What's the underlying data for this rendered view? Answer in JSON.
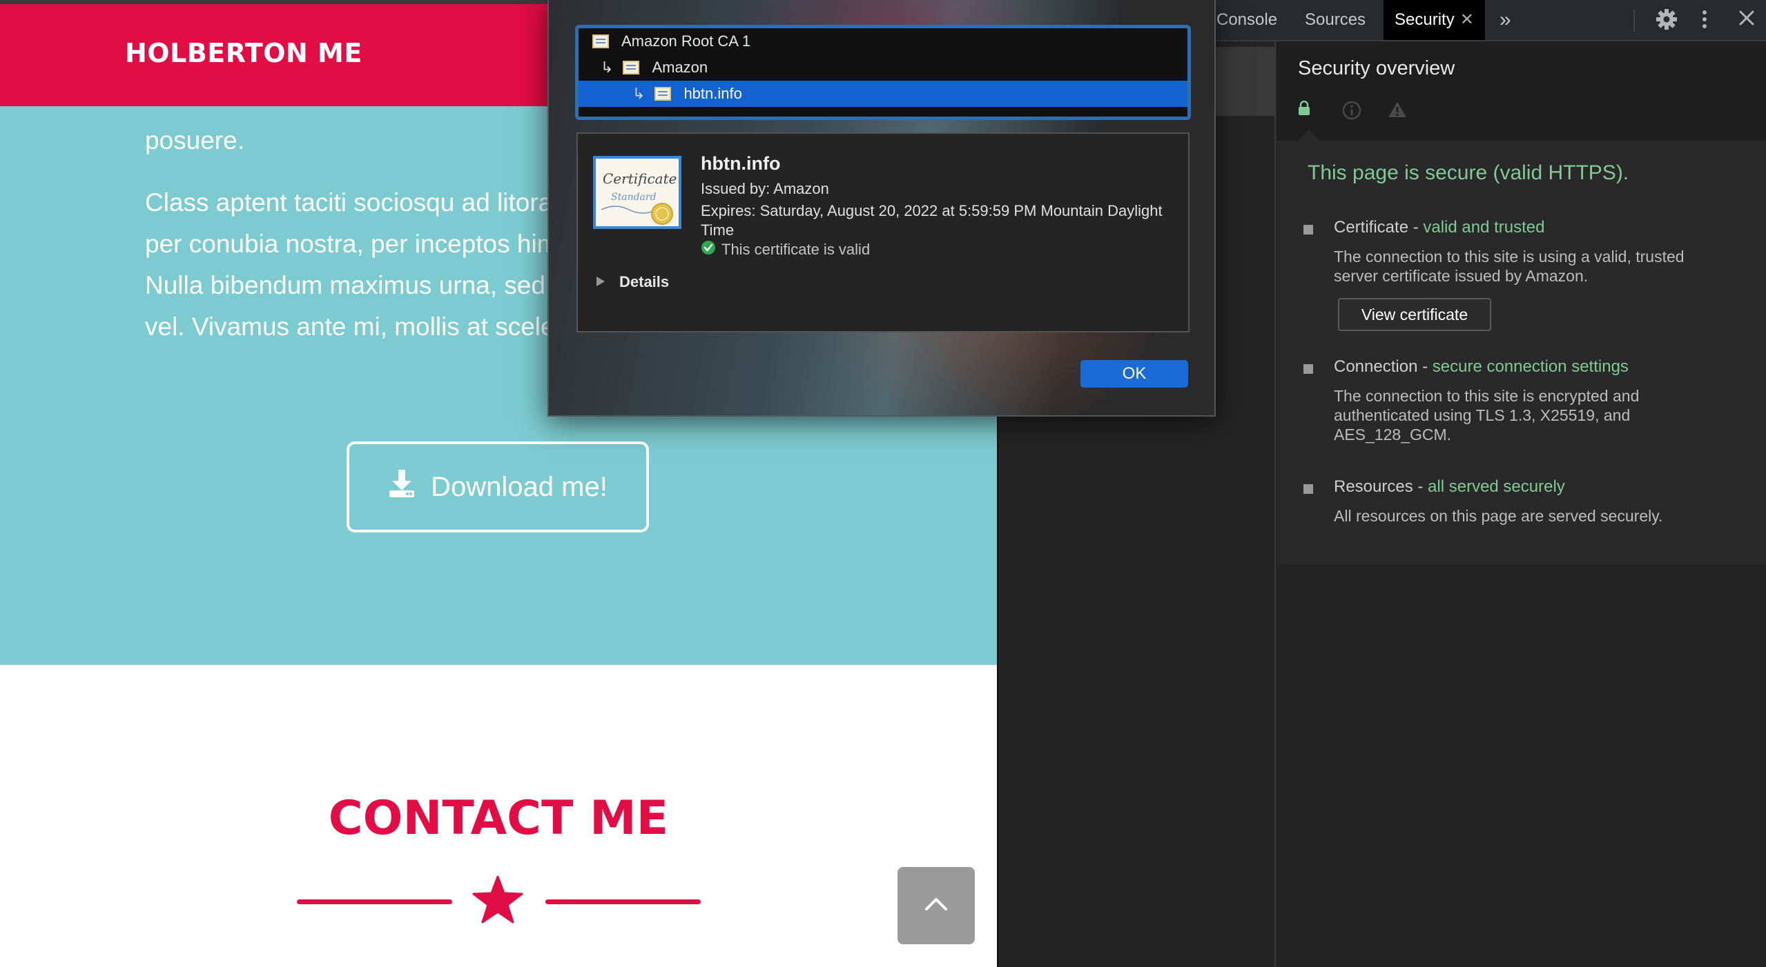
{
  "website": {
    "brand": "HOLBERTON ME",
    "para_partial_line": "posuere.",
    "paragraph": "Class aptent taciti sociosqu ad litora torquent per conubia nostra, per inceptos himenaeos. Nulla bibendum maximus urna, sed lacinia velit vel. Vivamus ante mi, mollis at scelerisque dui.",
    "download_label": "Download me!",
    "contact_title": "CONTACT ME",
    "colors": {
      "brand": "#e20d44",
      "teal": "#7ccbd0"
    },
    "icons": {
      "download": "download-icon",
      "star": "star-icon",
      "scroll_top": "chevron-up-icon"
    }
  },
  "devtools": {
    "tabs": [
      "Console",
      "Sources",
      "Security"
    ],
    "active_tab": "Security",
    "more_tabs_glyph": "»",
    "icons": [
      "settings-icon",
      "more-vertical-icon",
      "close-icon"
    ],
    "security": {
      "title": "Security overview",
      "secure_message": "This page is secure (valid HTTPS).",
      "certificate": {
        "label": "Certificate - ",
        "status": "valid and trusted",
        "description": "The connection to this site is using a valid, trusted server certificate issued by Amazon.",
        "button": "View certificate"
      },
      "connection": {
        "label": "Connection - ",
        "status": "secure connection settings",
        "description": "The connection to this site is encrypted and authenticated using TLS 1.3, X25519, and AES_128_GCM."
      },
      "resources": {
        "label": "Resources - ",
        "status": "all served securely",
        "description": "All resources on this page are served securely."
      },
      "colors": {
        "good": "#81c995"
      }
    }
  },
  "cert_dialog": {
    "chain": [
      {
        "name": "Amazon Root CA 1",
        "selected": false
      },
      {
        "name": "Amazon",
        "selected": false
      },
      {
        "name": "hbtn.info",
        "selected": true
      }
    ],
    "subject": "hbtn.info",
    "issued_by": "Issued by: Amazon",
    "expires": "Expires: Saturday, August 20, 2022 at 5:59:59 PM Mountain Daylight Time",
    "valid_text": "This certificate is valid",
    "details_label": "Details",
    "ok_label": "OK",
    "badge_text": {
      "title": "Certificate",
      "subtitle": "Standard"
    }
  }
}
